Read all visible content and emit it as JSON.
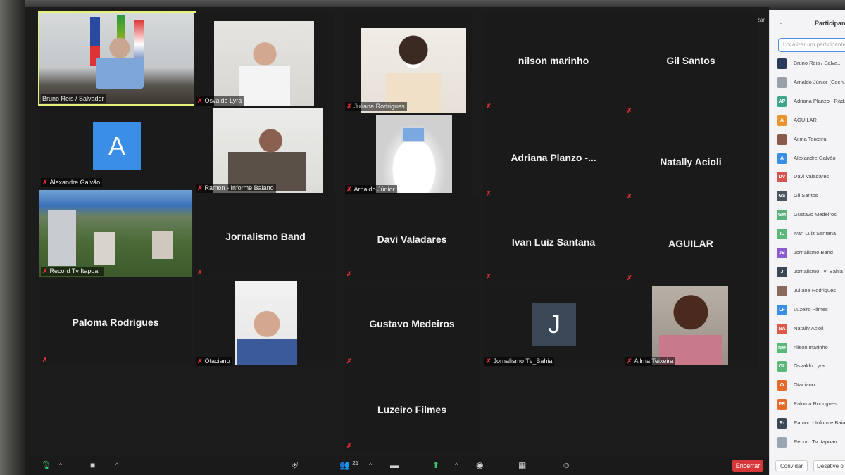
{
  "view_label": "Visualizar",
  "tiles": {
    "bruno": "Bruno Reis / Salvador",
    "osvaldo": "Osvaldo Lyra",
    "juliana": "Juliana Rodrigues",
    "nilson": "nilson marinho",
    "gil": "Gil Santos",
    "alexandre_initial": "A",
    "alexandre": "Alexandre Galvão",
    "ramon": "Ramon - Informe Baiano",
    "arnaldo": "Arnaldo Júnior",
    "adriana": "Adriana Planzo -...",
    "natally": "Natally Acioli",
    "record": "Record Tv Itapoan",
    "jornalismo_band": "Jornalismo Band",
    "davi": "Davi Valadares",
    "ivan": "Ivan Luiz Santana",
    "aguilar": "AGUILAR",
    "paloma": "Paloma Rodrigues",
    "otaciano": "Otaciano",
    "gustavo": "Gustavo Medeiros",
    "jornalismo_tv_initial": "J",
    "jornalismo_tv": "Jornalismo Tv_Bahia",
    "ailma": "Ailma Teixeira",
    "luzeiro": "Luzeiro Filmes"
  },
  "toolbar": {
    "participants_count": "21",
    "end_label": "Encerrar"
  },
  "panel": {
    "title": "Participantes",
    "search_placeholder": "Localizar um participante",
    "participants": [
      {
        "initials": "",
        "name": "Bruno Reis / Salva...",
        "color": "#2a3a5a"
      },
      {
        "initials": "",
        "name": "Arnaldo Júnior (Coen...",
        "color": "#9aa0a8"
      },
      {
        "initials": "AP",
        "name": "Adriana Planzo - Rád...",
        "color": "#3fa58a"
      },
      {
        "initials": "A",
        "name": "AGUILAR",
        "color": "#e8952e"
      },
      {
        "initials": "",
        "name": "Ailma Teixeira",
        "color": "#8a5a4a"
      },
      {
        "initials": "A",
        "name": "Alexandre Galvão",
        "color": "#3a8ee6"
      },
      {
        "initials": "DV",
        "name": "Davi Valadares",
        "color": "#d9534f"
      },
      {
        "initials": "GS",
        "name": "Gil Santos",
        "color": "#4a5560"
      },
      {
        "initials": "GM",
        "name": "Gustavo Medeiros",
        "color": "#5cb07a"
      },
      {
        "initials": "IL",
        "name": "Ivan Luiz Santana",
        "color": "#5cb87a"
      },
      {
        "initials": "JB",
        "name": "Jornalismo Band",
        "color": "#8a5ad0"
      },
      {
        "initials": "J",
        "name": "Jornalismo Tv_Bahia",
        "color": "#3a4858"
      },
      {
        "initials": "",
        "name": "Juliana Rodrigues",
        "color": "#8a6a5a"
      },
      {
        "initials": "LF",
        "name": "Luzeiro Filmes",
        "color": "#3a8ee6"
      },
      {
        "initials": "NA",
        "name": "Natally Acioli",
        "color": "#e05a4a"
      },
      {
        "initials": "NM",
        "name": "nilson marinho",
        "color": "#5cb87a"
      },
      {
        "initials": "OL",
        "name": "Osvaldo Lyra",
        "color": "#5cb87a"
      },
      {
        "initials": "O",
        "name": "Otaciano",
        "color": "#e86a2a"
      },
      {
        "initials": "PR",
        "name": "Paloma Rodrigues",
        "color": "#e86a2a"
      },
      {
        "initials": "R-",
        "name": "Ramon - Informe Baia...",
        "color": "#3a4858"
      },
      {
        "initials": "",
        "name": "Record Tv Itapoan",
        "color": "#9aa6b4"
      }
    ],
    "invite_label": "Convidar",
    "mute_all_label": "Desative o So..."
  }
}
